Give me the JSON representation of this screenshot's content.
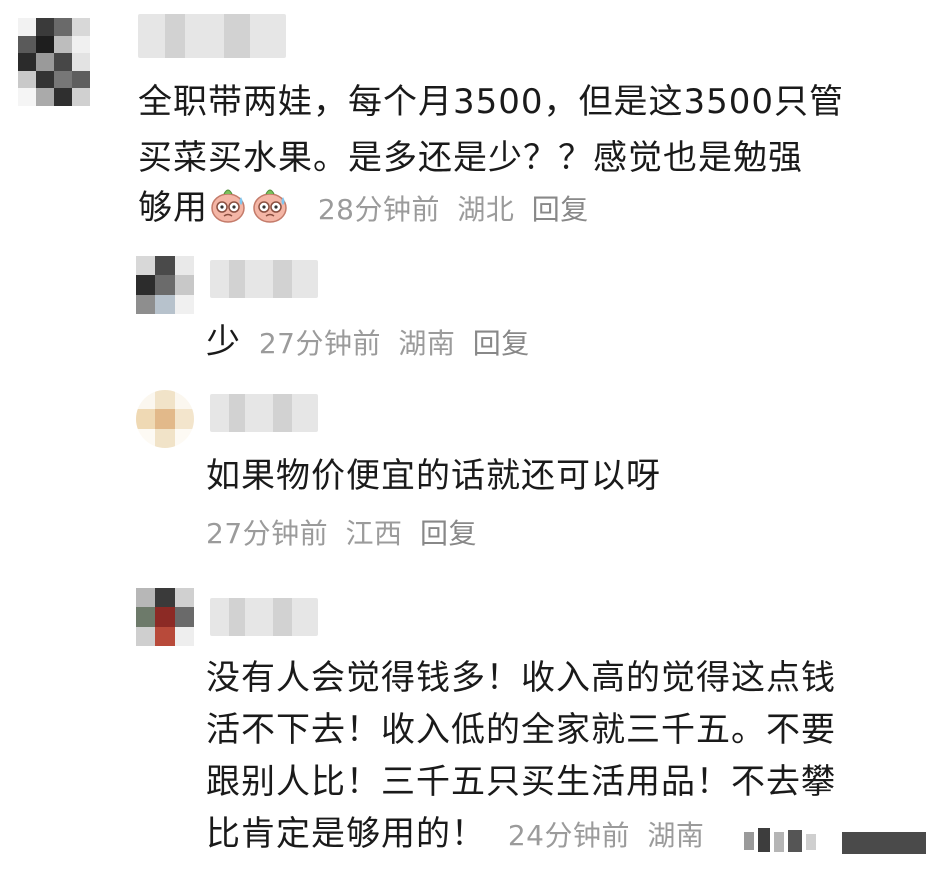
{
  "comments": [
    {
      "lines": [
        "全职带两娃，每个月3500，但是这3500只管",
        "买菜买水果。是多还是少？？感觉也是勉强",
        "够用"
      ],
      "emoji_icon": "sweating-face-emoji",
      "time": "28分钟前",
      "location": "湖北",
      "reply_label": "回复"
    },
    {
      "lines": [
        "少"
      ],
      "time": "27分钟前",
      "location": "湖南",
      "reply_label": "回复"
    },
    {
      "lines": [
        "如果物价便宜的话就还可以呀"
      ],
      "time": "27分钟前",
      "location": "江西",
      "reply_label": "回复"
    },
    {
      "lines": [
        "没有人会觉得钱多！收入高的觉得这点钱",
        "活不下去！收入低的全家就三千五。不要",
        "跟别人比！三千五只买生活用品！不去攀",
        "比肯定是够用的！"
      ],
      "time": "24分钟前",
      "location": "湖南"
    }
  ],
  "colors": {
    "text": "#1a1a1a",
    "meta": "#9b9b9b",
    "background": "#ffffff"
  }
}
